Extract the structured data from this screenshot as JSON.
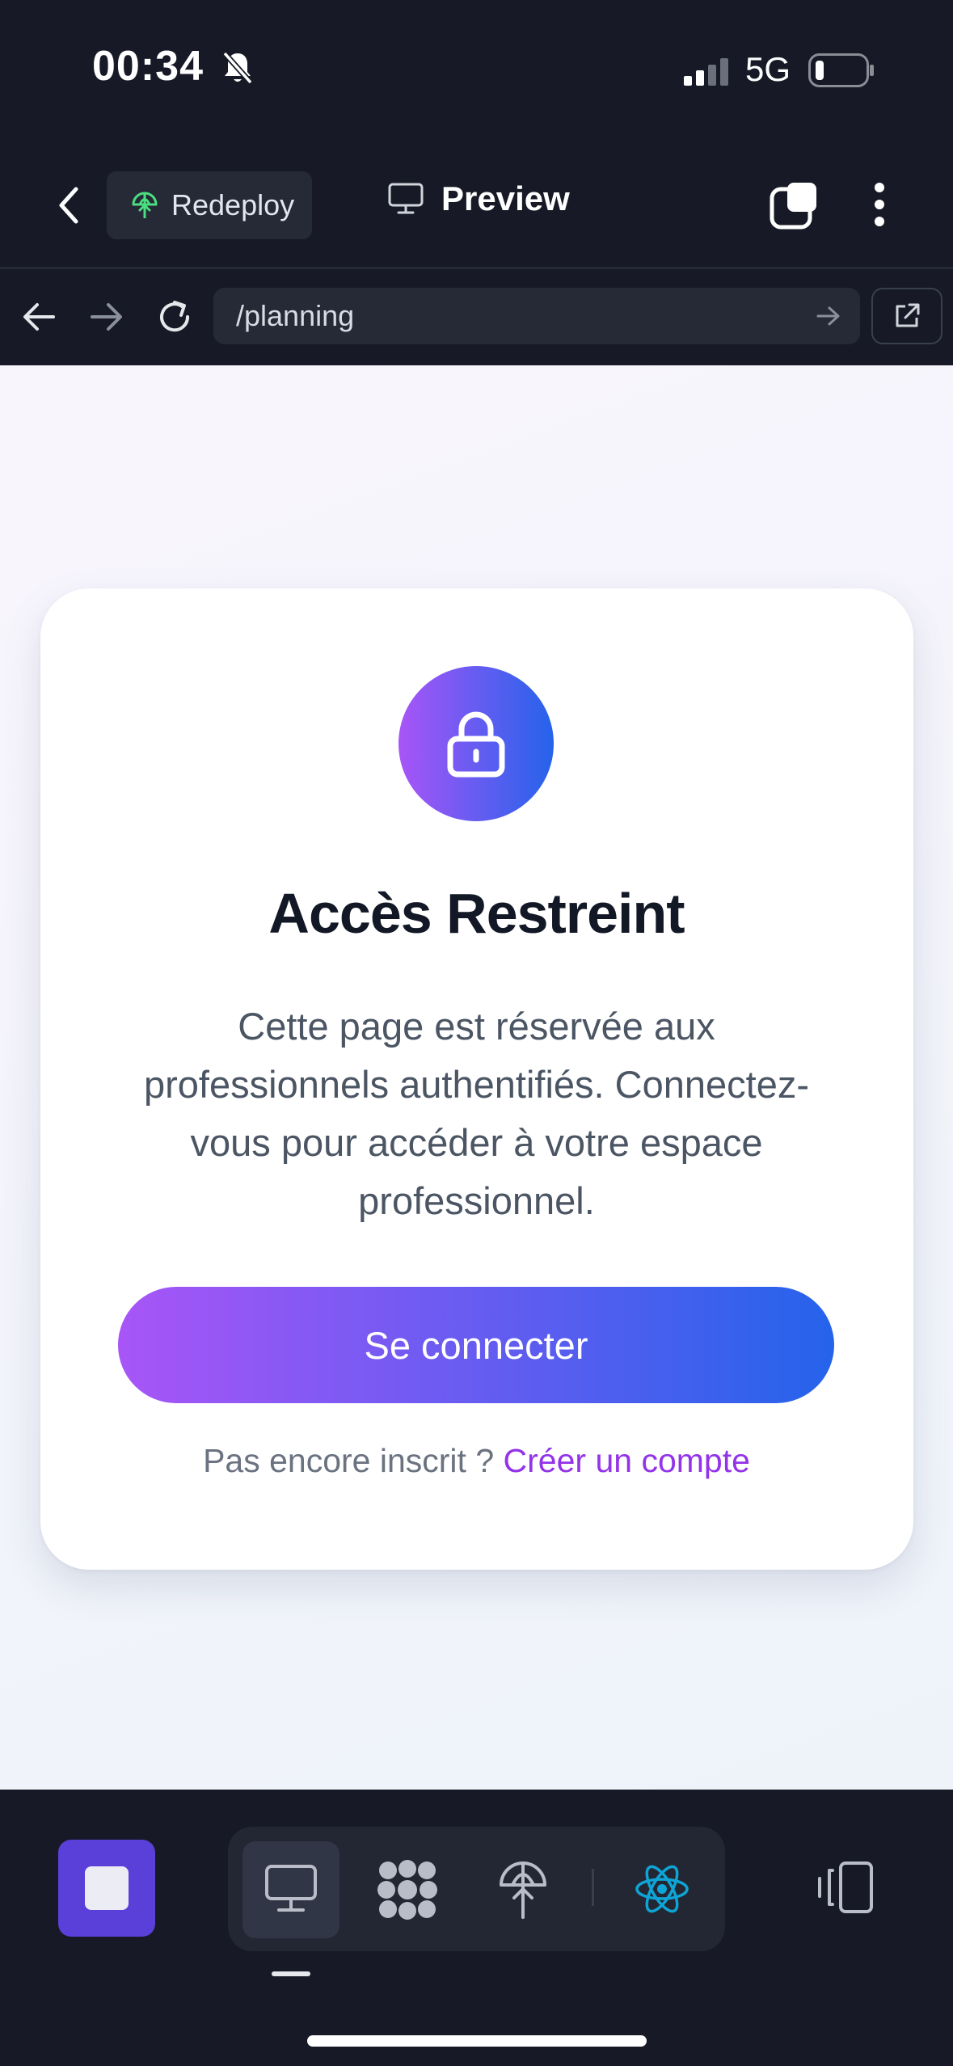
{
  "status_bar": {
    "time": "00:34",
    "network": "5G",
    "silent_icon": "bell-slash-icon",
    "signal_icon": "cellular-signal-icon",
    "battery_icon": "battery-low-icon"
  },
  "header": {
    "back_icon": "chevron-left-icon",
    "redeploy_label": "Redeploy",
    "preview_label": "Preview",
    "tabs_icon": "tabs-icon",
    "menu_icon": "more-vertical-icon"
  },
  "address_bar": {
    "url": "/planning",
    "back_icon": "arrow-left-icon",
    "forward_icon": "arrow-right-icon",
    "reload_icon": "reload-icon",
    "go_icon": "arrow-right-icon",
    "open_external_icon": "external-link-icon"
  },
  "page": {
    "title": "Accès Restreint",
    "description": "Cette page est réservée aux professionnels authentifiés. Connectez-vous pour accéder à votre espace professionnel.",
    "login_button": "Se connecter",
    "signup_prompt": "Pas encore inscrit ?",
    "signup_link": "Créer un compte"
  },
  "toolbar": {
    "items": [
      "stop",
      "desktop",
      "grid",
      "deploy",
      "react",
      "devices"
    ]
  },
  "colors": {
    "gradient_start": "#a855f7",
    "gradient_end": "#2563eb",
    "link": "#9333ea",
    "stop_button": "#5b3fd9",
    "react": "#0ea5d6"
  }
}
